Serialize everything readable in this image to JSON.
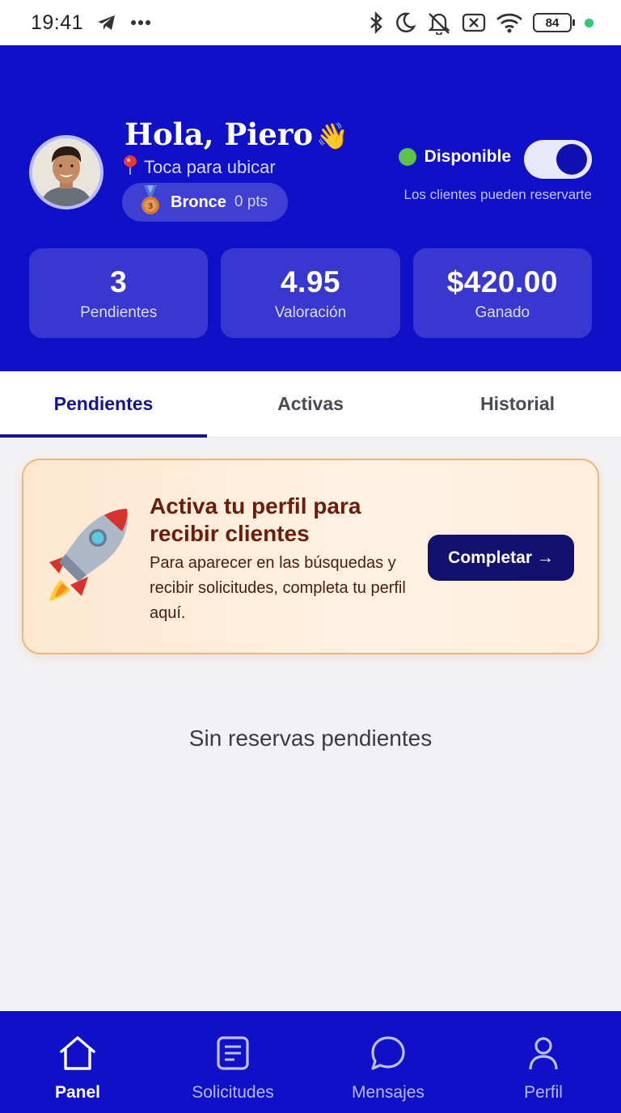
{
  "status_bar": {
    "time": "19:41",
    "battery": "84",
    "icons": [
      "telegram-icon",
      "more-icon",
      "bluetooth-icon",
      "moon-icon",
      "bell-off-icon",
      "no-sim-icon",
      "wifi-icon",
      "battery-icon"
    ]
  },
  "header": {
    "greeting": "Hola, Piero",
    "greeting_emoji": "👋",
    "location_text": "Toca para ubicar",
    "rank": {
      "name": "Bronce",
      "points": "0 pts"
    },
    "availability": {
      "label": "Disponible",
      "subtitle": "Los clientes pueden reservarte",
      "enabled": true
    },
    "stats": [
      {
        "value": "3",
        "label": "Pendientes"
      },
      {
        "value": "4.95",
        "label": "Valoración"
      },
      {
        "value": "$420.00",
        "label": "Ganado"
      }
    ]
  },
  "tabs": [
    {
      "label": "Pendientes",
      "active": true
    },
    {
      "label": "Activas",
      "active": false
    },
    {
      "label": "Historial",
      "active": false
    }
  ],
  "promo": {
    "title": "Activa tu perfil para recibir clientes",
    "body": "Para aparecer en las búsquedas y recibir solicitudes, completa tu perfil aquí.",
    "button_label": "Completar →"
  },
  "empty_state": "Sin reservas pendientes",
  "bottom_nav": [
    {
      "label": "Panel",
      "icon": "home-icon",
      "active": true
    },
    {
      "label": "Solicitudes",
      "icon": "document-list-icon",
      "active": false
    },
    {
      "label": "Mensajes",
      "icon": "chat-bubble-icon",
      "active": false
    },
    {
      "label": "Perfil",
      "icon": "user-icon",
      "active": false
    }
  ],
  "colors": {
    "primary": "#1010c8",
    "accent_dark": "#12126e",
    "promo_bg": "#fde7d0",
    "promo_border": "#f0b680",
    "available_dot": "#5cc24a"
  }
}
